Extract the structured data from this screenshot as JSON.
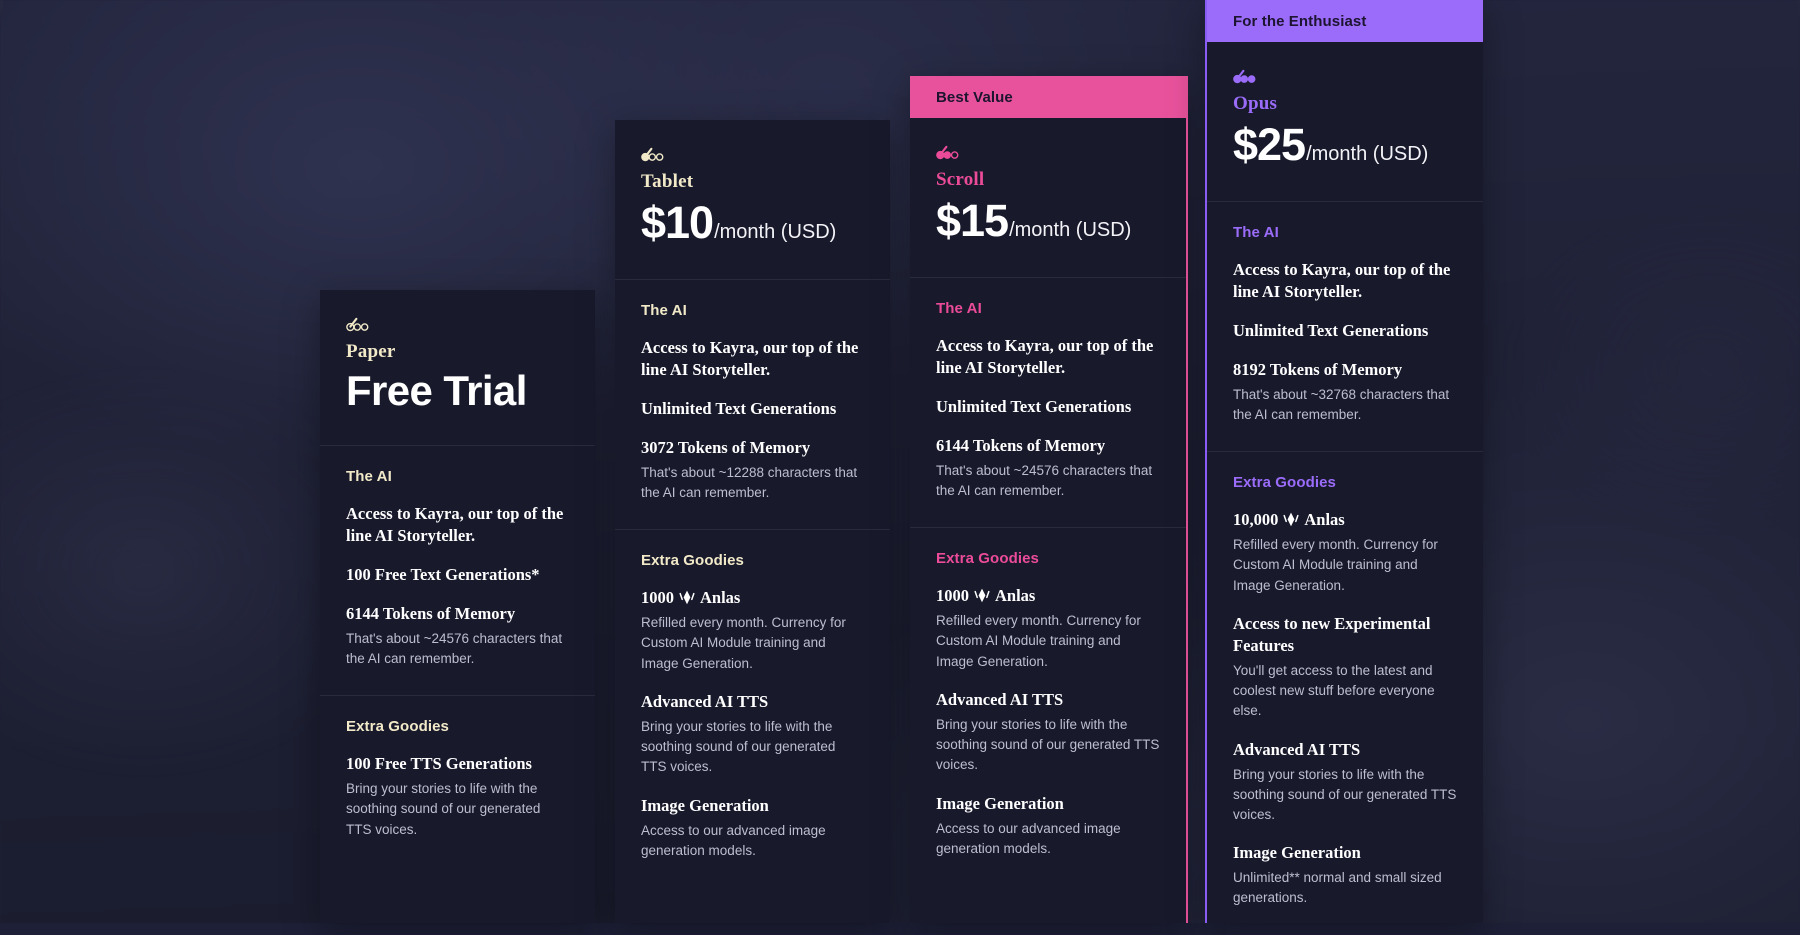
{
  "page": {
    "background_color": "#1e2038",
    "card_background": "#181a2c"
  },
  "colors": {
    "cream": "#f2e9c8",
    "pink": "#ec4b99",
    "purple": "#9b6cfa",
    "ribbon_pink": "#e8529c",
    "ribbon_purple": "#9b6cfa",
    "body_text": "#bdbfd0"
  },
  "plans": [
    {
      "id": "paper",
      "ribbon": null,
      "icon_name": "paper-tier-icon",
      "tier": "Paper",
      "headline": "Free Trial",
      "price": null,
      "per": null,
      "accent": "cream",
      "sections": [
        {
          "title": "The AI",
          "features": [
            {
              "name": "Access to Kayra, our top of the line AI Storyteller.",
              "desc": null
            },
            {
              "name": "100 Free Text Generations*",
              "desc": null
            },
            {
              "name": "6144 Tokens of Memory",
              "desc": "That's about ~24576 characters that the AI can remember."
            }
          ]
        },
        {
          "title": "Extra Goodies",
          "features": [
            {
              "name": "100 Free TTS Generations",
              "desc": "Bring your stories to life with the soothing sound of our generated TTS voices."
            }
          ]
        }
      ]
    },
    {
      "id": "tablet",
      "ribbon": null,
      "icon_name": "tablet-tier-icon",
      "tier": "Tablet",
      "headline": null,
      "price": "$10",
      "per": "/month (USD)",
      "accent": "cream",
      "sections": [
        {
          "title": "The AI",
          "features": [
            {
              "name": "Access to Kayra, our top of the line AI Storyteller.",
              "desc": null
            },
            {
              "name": "Unlimited Text Generations",
              "desc": null
            },
            {
              "name": "3072 Tokens of Memory",
              "desc": "That's about ~12288 characters that the AI can remember."
            }
          ]
        },
        {
          "title": "Extra Goodies",
          "features": [
            {
              "name_prefix": "1000",
              "icon": "anlas-icon",
              "name_suffix": "Anlas",
              "desc": "Refilled every month. Currency for Custom AI Module training and Image Generation."
            },
            {
              "name": "Advanced AI TTS",
              "desc": "Bring your stories to life with the soothing sound of our generated TTS voices."
            },
            {
              "name": "Image Generation",
              "desc": "Access to our advanced image generation models."
            }
          ]
        }
      ]
    },
    {
      "id": "scroll",
      "ribbon": "Best Value",
      "ribbon_style": "pink",
      "icon_name": "scroll-tier-icon",
      "tier": "Scroll",
      "headline": null,
      "price": "$15",
      "per": "/month (USD)",
      "accent": "pink",
      "sections": [
        {
          "title": "The AI",
          "features": [
            {
              "name": "Access to Kayra, our top of the line AI Storyteller.",
              "desc": null
            },
            {
              "name": "Unlimited Text Generations",
              "desc": null
            },
            {
              "name": "6144 Tokens of Memory",
              "desc": "That's about ~24576 characters that the AI can remember."
            }
          ]
        },
        {
          "title": "Extra Goodies",
          "features": [
            {
              "name_prefix": "1000",
              "icon": "anlas-icon",
              "name_suffix": "Anlas",
              "desc": "Refilled every month. Currency for Custom AI Module training and Image Generation."
            },
            {
              "name": "Advanced AI TTS",
              "desc": "Bring your stories to life with the soothing sound of our generated TTS voices."
            },
            {
              "name": "Image Generation",
              "desc": "Access to our advanced image generation models."
            }
          ]
        }
      ]
    },
    {
      "id": "opus",
      "ribbon": "For the Enthusiast",
      "ribbon_style": "purple",
      "icon_name": "opus-tier-icon",
      "tier": "Opus",
      "headline": null,
      "price": "$25",
      "per": "/month (USD)",
      "accent": "purple",
      "sections": [
        {
          "title": "The AI",
          "features": [
            {
              "name": "Access to Kayra, our top of the line AI Storyteller.",
              "desc": null
            },
            {
              "name": "Unlimited Text Generations",
              "desc": null
            },
            {
              "name": "8192 Tokens of Memory",
              "desc": "That's about ~32768 characters that the AI can remember."
            }
          ]
        },
        {
          "title": "Extra Goodies",
          "features": [
            {
              "name_prefix": "10,000",
              "icon": "anlas-icon",
              "name_suffix": "Anlas",
              "desc": "Refilled every month. Currency for Custom AI Module training and Image Generation."
            },
            {
              "name": "Access to new Experimental Features",
              "desc": "You'll get access to the latest and coolest new stuff before everyone else."
            },
            {
              "name": "Advanced AI TTS",
              "desc": "Bring your stories to life with the soothing sound of our generated TTS voices."
            },
            {
              "name": "Image Generation",
              "desc": "Unlimited** normal and small sized generations."
            }
          ]
        }
      ]
    }
  ]
}
